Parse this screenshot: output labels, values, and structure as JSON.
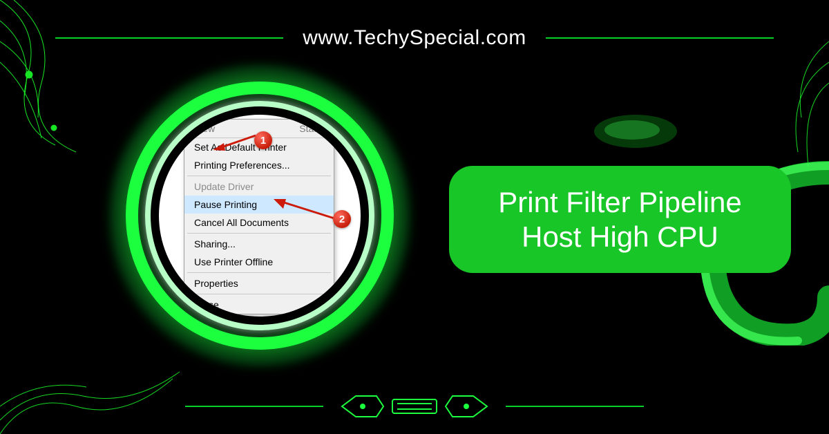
{
  "site": {
    "url": "www.TechySpecial.com"
  },
  "title": {
    "line1": "Print Filter Pipeline",
    "line2": "Host High CPU"
  },
  "menu": {
    "top_view": "View",
    "top_status": "Status",
    "set_default": "Set As Default Printer",
    "preferences": "Printing Preferences...",
    "update_driver": "Update Driver",
    "pause": "Pause Printing",
    "cancel_all": "Cancel All Documents",
    "sharing": "Sharing...",
    "offline": "Use Printer Offline",
    "properties": "Properties",
    "close": "Close"
  },
  "badges": {
    "one": "1",
    "two": "2"
  },
  "colors": {
    "accent": "#18c628",
    "neon": "#1bff3f",
    "badge": "#c81e0b"
  }
}
